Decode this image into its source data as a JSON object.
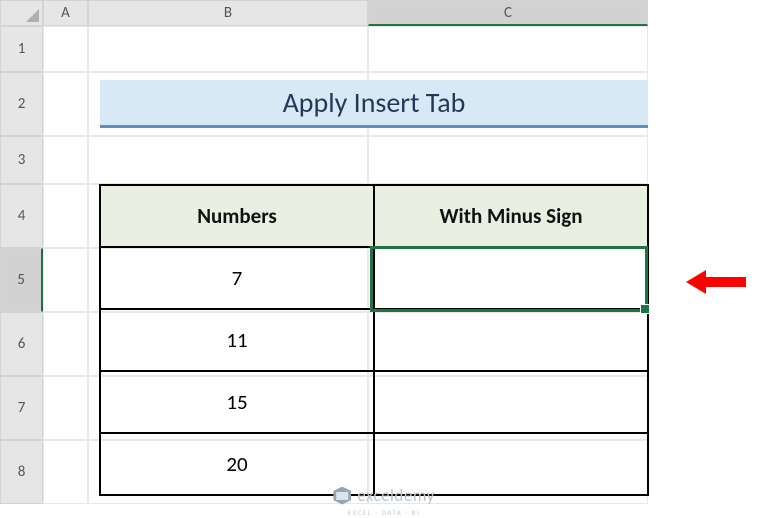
{
  "columns": {
    "a": "A",
    "b": "B",
    "c": "C"
  },
  "rows": {
    "r1": "1",
    "r2": "2",
    "r3": "3",
    "r4": "4",
    "r5": "5",
    "r6": "6",
    "r7": "7",
    "r8": "8"
  },
  "title": "Apply Insert Tab",
  "table": {
    "headers": {
      "col1": "Numbers",
      "col2": "With Minus Sign"
    },
    "data": {
      "n1": "7",
      "n2": "11",
      "n3": "15",
      "n4": "20",
      "m1": "",
      "m2": "",
      "m3": "",
      "m4": ""
    }
  },
  "watermark": {
    "text": "exceldemy",
    "sub": "EXCEL · DATA · BI"
  },
  "selected_cell": "C5",
  "chart_data": {
    "type": "table",
    "title": "Apply Insert Tab",
    "columns": [
      "Numbers",
      "With Minus Sign"
    ],
    "rows": [
      [
        7,
        null
      ],
      [
        11,
        null
      ],
      [
        15,
        null
      ],
      [
        20,
        null
      ]
    ]
  }
}
